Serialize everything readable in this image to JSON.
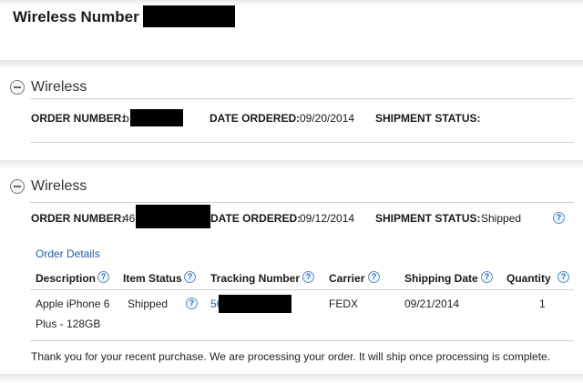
{
  "page": {
    "title": "Wireless Number - 4"
  },
  "orders": [
    {
      "section_title": "Wireless",
      "order_number_label": "ORDER NUMBER:",
      "order_number_value": "b",
      "date_ordered_label": "DATE ORDERED:",
      "date_ordered_value": "09/20/2014",
      "shipment_status_label": "SHIPMENT STATUS:",
      "shipment_status_value": ""
    },
    {
      "section_title": "Wireless",
      "order_number_label": "ORDER NUMBER:",
      "order_number_value": "46",
      "date_ordered_label": "DATE ORDERED:",
      "date_ordered_value": "09/12/2014",
      "shipment_status_label": "SHIPMENT STATUS:",
      "shipment_status_value": "Shipped",
      "order_details_link": "Order Details",
      "table": {
        "headers": [
          "Description",
          "Item Status",
          "Tracking Number",
          "Carrier",
          "Shipping Date",
          "Quantity"
        ],
        "row": {
          "description_line1": "Apple iPhone 6",
          "description_line2": "Plus - 128GB",
          "item_status": "Shipped",
          "tracking_number": "56",
          "carrier": "FEDX",
          "shipping_date": "09/21/2014",
          "quantity": "1"
        }
      },
      "footer_message": "Thank you for your recent purchase. We are processing your order. It will ship once processing is complete."
    }
  ],
  "icons": {
    "collapse": "minus-circle-icon",
    "help": "question-mark-icon"
  },
  "help_glyph": "?",
  "colors": {
    "link": "#1f5fa6",
    "help_icon": "#2b6cb0",
    "redaction": "#000000"
  }
}
